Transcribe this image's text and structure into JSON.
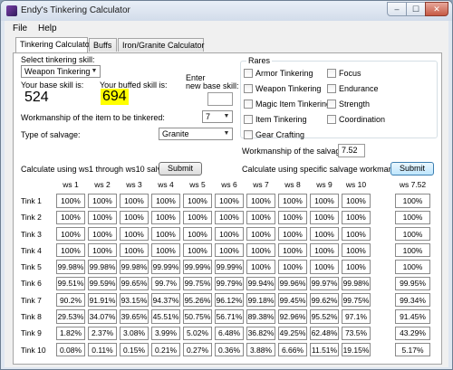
{
  "window": {
    "title": "Endy's Tinkering Calculator",
    "min_glyph": "–",
    "max_glyph": "☐",
    "close_glyph": "✕"
  },
  "menu": [
    "File",
    "Help"
  ],
  "tabs": [
    "Tinkering Calculator",
    "Buffs",
    "Iron/Granite Calculator"
  ],
  "form": {
    "select_skill_label": "Select tinkering skill:",
    "skill_value": "Weapon Tinkering",
    "base_skill_label": "Your base skill is:",
    "base_skill_value": "524",
    "buffed_skill_label": "Your buffed skill is:",
    "buffed_skill_value": "694",
    "enter_new_label_1": "Enter",
    "enter_new_label_2": "new base skill:",
    "new_base_value": "",
    "workmanship_label": "Workmanship of the item to be tinkered:",
    "workmanship_value": "7",
    "salvage_type_label": "Type of salvage:",
    "salvage_type_value": "Granite",
    "salvage_workmanship_label": "Workmanship of the salvage:",
    "salvage_workmanship_value": "7.52",
    "calc_ws_label": "Calculate using ws1 through ws10 salvage:",
    "calc_specific_label": "Calculate using specific salvage workmanship:",
    "submit_label": "Submit",
    "submit2_label": "Submit"
  },
  "rares": {
    "title": "Rares",
    "left": [
      "Armor Tinkering",
      "Weapon Tinkering",
      "Magic Item Tinkering",
      "Item Tinkering",
      "Gear Crafting"
    ],
    "right": [
      "Focus",
      "Endurance",
      "Strength",
      "Coordination"
    ]
  },
  "grid": {
    "headers": [
      "ws 1",
      "ws 2",
      "ws 3",
      "ws 4",
      "ws 5",
      "ws 6",
      "ws 7",
      "ws 8",
      "ws 9",
      "ws 10"
    ],
    "rows": [
      {
        "label": "Tink 1",
        "values": [
          "100%",
          "100%",
          "100%",
          "100%",
          "100%",
          "100%",
          "100%",
          "100%",
          "100%",
          "100%"
        ]
      },
      {
        "label": "Tink 2",
        "values": [
          "100%",
          "100%",
          "100%",
          "100%",
          "100%",
          "100%",
          "100%",
          "100%",
          "100%",
          "100%"
        ]
      },
      {
        "label": "Tink 3",
        "values": [
          "100%",
          "100%",
          "100%",
          "100%",
          "100%",
          "100%",
          "100%",
          "100%",
          "100%",
          "100%"
        ]
      },
      {
        "label": "Tink 4",
        "values": [
          "100%",
          "100%",
          "100%",
          "100%",
          "100%",
          "100%",
          "100%",
          "100%",
          "100%",
          "100%"
        ]
      },
      {
        "label": "Tink 5",
        "values": [
          "99.98%",
          "99.98%",
          "99.98%",
          "99.99%",
          "99.99%",
          "99.99%",
          "100%",
          "100%",
          "100%",
          "100%"
        ]
      },
      {
        "label": "Tink 6",
        "values": [
          "99.51%",
          "99.59%",
          "99.65%",
          "99.7%",
          "99.75%",
          "99.79%",
          "99.94%",
          "99.96%",
          "99.97%",
          "99.98%"
        ]
      },
      {
        "label": "Tink 7",
        "values": [
          "90.2%",
          "91.91%",
          "93.15%",
          "94.37%",
          "95.26%",
          "96.12%",
          "99.18%",
          "99.45%",
          "99.62%",
          "99.75%"
        ]
      },
      {
        "label": "Tink 8",
        "values": [
          "29.53%",
          "34.07%",
          "39.65%",
          "45.51%",
          "50.75%",
          "56.71%",
          "89.38%",
          "92.96%",
          "95.52%",
          "97.1%"
        ]
      },
      {
        "label": "Tink 9",
        "values": [
          "1.82%",
          "2.37%",
          "3.08%",
          "3.99%",
          "5.02%",
          "6.48%",
          "36.82%",
          "49.25%",
          "62.48%",
          "73.5%"
        ]
      },
      {
        "label": "Tink 10",
        "values": [
          "0.08%",
          "0.11%",
          "0.15%",
          "0.21%",
          "0.27%",
          "0.36%",
          "3.88%",
          "6.66%",
          "11.51%",
          "19.15%"
        ]
      }
    ]
  },
  "specific": {
    "header": "ws 7.52",
    "values": [
      "100%",
      "100%",
      "100%",
      "100%",
      "100%",
      "99.95%",
      "99.34%",
      "91.45%",
      "43.29%",
      "5.17%"
    ]
  }
}
